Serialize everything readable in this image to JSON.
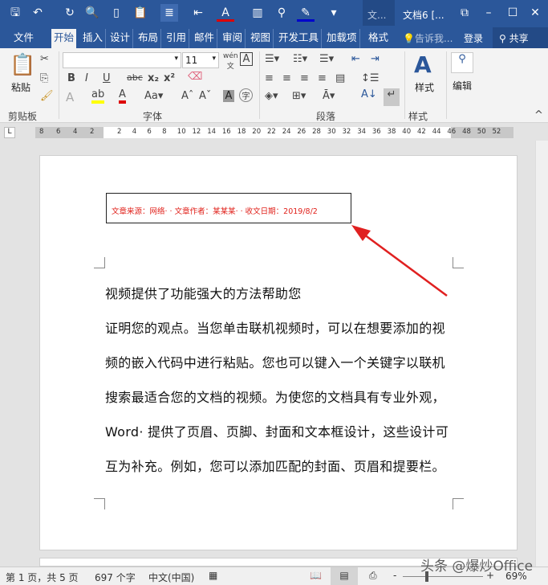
{
  "titlebar": {
    "context_tab": "文...",
    "doc_title": "文档6 [..."
  },
  "tabs": [
    {
      "label": "文件"
    },
    {
      "label": "开始"
    },
    {
      "label": "插入"
    },
    {
      "label": "设计"
    },
    {
      "label": "布局"
    },
    {
      "label": "引用"
    },
    {
      "label": "邮件"
    },
    {
      "label": "审阅"
    },
    {
      "label": "视图"
    },
    {
      "label": "开发工具"
    },
    {
      "label": "加载项"
    },
    {
      "label": "格式"
    }
  ],
  "tell_me": "告诉我...",
  "login": "登录",
  "share": "共享",
  "ribbon": {
    "paste": "粘贴",
    "font_name": "",
    "font_size": "11",
    "styles": "样式",
    "edit": "编辑",
    "groups": {
      "clipboard": "剪贴板",
      "font": "字体",
      "paragraph": "段落",
      "styles": "样式"
    }
  },
  "ruler": {
    "left": [
      "8",
      "6",
      "4",
      "2"
    ],
    "right": [
      "2",
      "4",
      "6",
      "8",
      "10",
      "12",
      "14",
      "16",
      "18",
      "20",
      "22",
      "24",
      "26",
      "28",
      "30",
      "32",
      "34",
      "36",
      "38",
      "40",
      "42",
      "44",
      "46",
      "48",
      "50",
      "52"
    ]
  },
  "document": {
    "header": "文章来源：网络· · 文章作者：某某某· · 收文日期：2019/8/2",
    "lines": [
      "视频提供了功能强大的方法帮助您",
      "证明您的观点。当您单击联机视频时，可以在想要添加的视",
      "频的嵌入代码中进行粘贴。您也可以键入一个关键字以联机",
      "搜索最适合您的文档的视频。为使您的文档具有专业外观，",
      "Word· 提供了页眉、页脚、封面和文本框设计，这些设计可",
      "互为补充。例如，您可以添加匹配的封面、页眉和提要栏。"
    ]
  },
  "status": {
    "page": "第 1 页，共 5 页",
    "words": "697 个字",
    "lang": "中文(中国)",
    "zoom": "69%"
  },
  "watermark": "头条 @爆炒Office",
  "colors": {
    "brand": "#2b579a",
    "header_text": "#e0201a",
    "arrow": "#e02020"
  }
}
